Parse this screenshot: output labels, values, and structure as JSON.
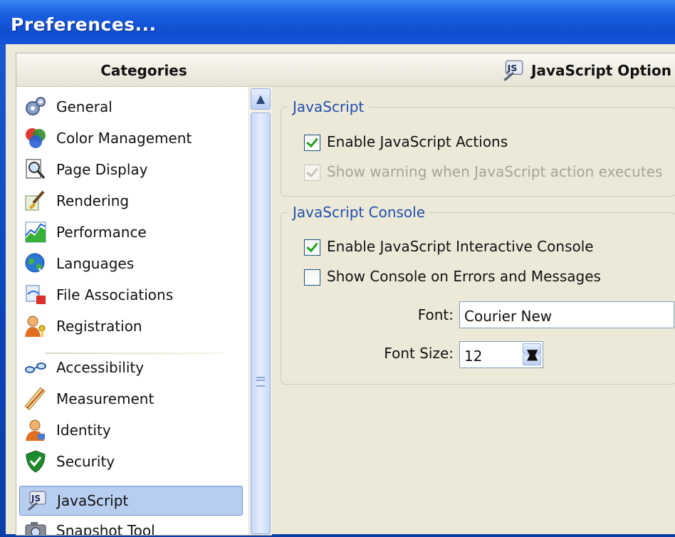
{
  "window": {
    "title": "Preferences..."
  },
  "categories": {
    "header": "Categories",
    "items": [
      {
        "label": "General",
        "icon": "gears-icon"
      },
      {
        "label": "Color Management",
        "icon": "color-wheel-icon"
      },
      {
        "label": "Page Display",
        "icon": "magnifier-page-icon"
      },
      {
        "label": "Rendering",
        "icon": "brush-icon"
      },
      {
        "label": "Performance",
        "icon": "performance-chart-icon"
      },
      {
        "label": "Languages",
        "icon": "globe-icon"
      },
      {
        "label": "File Associations",
        "icon": "file-association-icon"
      },
      {
        "label": "Registration",
        "icon": "user-key-icon"
      },
      {
        "label": "Accessibility",
        "icon": "glasses-icon"
      },
      {
        "label": "Measurement",
        "icon": "ruler-pencil-icon"
      },
      {
        "label": "Identity",
        "icon": "person-icon"
      },
      {
        "label": "Security",
        "icon": "shield-check-icon"
      },
      {
        "label": "JavaScript",
        "icon": "javascript-icon"
      },
      {
        "label": "Snapshot Tool",
        "icon": "camera-icon"
      }
    ],
    "selected": "JavaScript"
  },
  "content": {
    "header": "JavaScript Option",
    "groups": [
      {
        "legend": "JavaScript",
        "options": [
          {
            "label": "Enable JavaScript Actions",
            "checked": true,
            "enabled": true
          },
          {
            "label": "Show warning when JavaScript action executes",
            "checked": true,
            "enabled": false
          }
        ]
      },
      {
        "legend": "JavaScript Console",
        "options": [
          {
            "label": "Enable JavaScript Interactive Console",
            "checked": true,
            "enabled": true
          },
          {
            "label": "Show Console on Errors and Messages",
            "checked": false,
            "enabled": true
          }
        ],
        "font_label": "Font:",
        "font_value": "Courier New",
        "font_size_label": "Font Size:",
        "font_size_value": "12"
      }
    ]
  },
  "colors": {
    "title_bar": "#1a5fe0",
    "legend_text": "#1f4fae",
    "selection": "#b8cef0",
    "check": "#21a121"
  }
}
